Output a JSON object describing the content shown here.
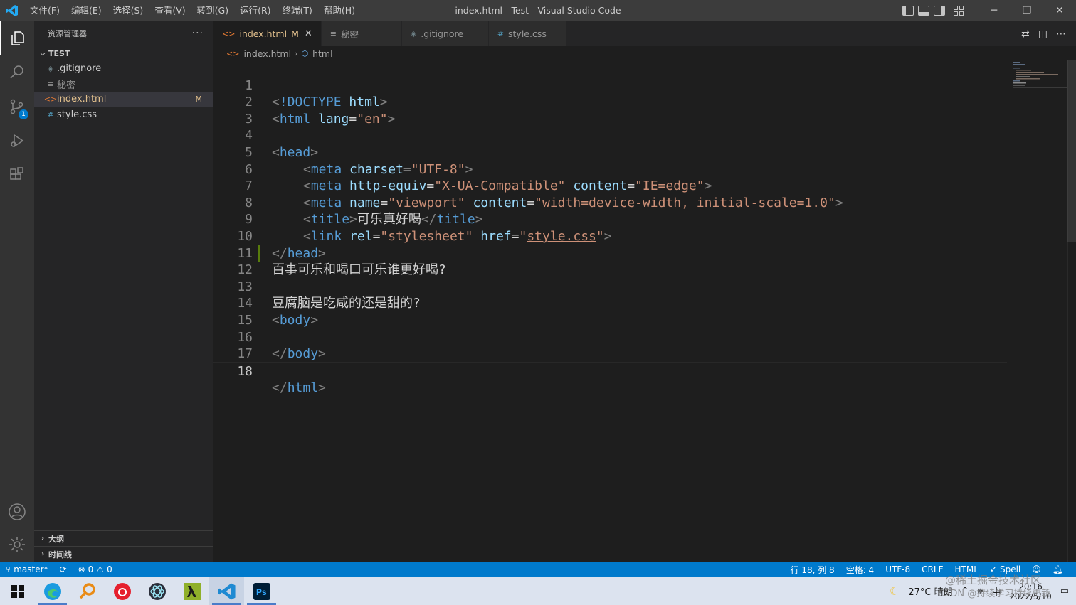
{
  "window": {
    "title": "index.html - Test - Visual Studio Code",
    "menu": [
      "文件(F)",
      "编辑(E)",
      "选择(S)",
      "查看(V)",
      "转到(G)",
      "运行(R)",
      "终端(T)",
      "帮助(H)"
    ],
    "minimize": "─",
    "restore": "❐",
    "close": "✕"
  },
  "activity": {
    "scm_badge": "1"
  },
  "sidebar": {
    "title": "资源管理器",
    "more": "···",
    "section": "TEST",
    "files": [
      {
        "name": ".gitignore",
        "icon": "◈"
      },
      {
        "name": "秘密",
        "icon": "≡"
      },
      {
        "name": "index.html",
        "icon": "<>",
        "status": "M"
      },
      {
        "name": "style.css",
        "icon": "#"
      }
    ],
    "outline": "大纲",
    "timeline": "时间线"
  },
  "tabs": [
    {
      "label": "index.html",
      "icon": "<>",
      "status": "M",
      "close": "✕"
    },
    {
      "label": "秘密",
      "icon": "≡"
    },
    {
      "label": ".gitignore",
      "icon": "◈"
    },
    {
      "label": "style.css",
      "icon": "#"
    }
  ],
  "breadcrumb": {
    "file": "index.html",
    "sep": "›",
    "symbol": "html"
  },
  "editor": {
    "lines": [
      {
        "n": "1"
      },
      {
        "n": "2"
      },
      {
        "n": "3"
      },
      {
        "n": "4"
      },
      {
        "n": "5"
      },
      {
        "n": "6"
      },
      {
        "n": "7"
      },
      {
        "n": "8"
      },
      {
        "n": "9"
      },
      {
        "n": "10"
      },
      {
        "n": "11"
      },
      {
        "n": "12"
      },
      {
        "n": "13"
      },
      {
        "n": "14"
      },
      {
        "n": "15"
      },
      {
        "n": "16"
      },
      {
        "n": "17"
      },
      {
        "n": "18"
      }
    ],
    "tok": {
      "lt": "<",
      "gt": ">",
      "lts": "</",
      "eq": "=",
      "q": "\"",
      "sp": " ",
      "doctype": "!DOCTYPE",
      "html": "html",
      "lang": "lang",
      "en": "\"en\"",
      "head": "head",
      "meta": "meta",
      "charset": "charset",
      "utf8": "\"UTF-8\"",
      "httpequiv": "http-equiv",
      "xua": "\"X-UA-Compatible\"",
      "content": "content",
      "ieedge": "\"IE=edge\"",
      "name": "name",
      "viewport": "\"viewport\"",
      "vpcontent": "\"width=device-width, initial-scale=1.0\"",
      "title": "title",
      "titletext": "可乐真好喝",
      "link": "link",
      "rel": "rel",
      "stylesheet": "\"stylesheet\"",
      "href": "href",
      "stylecss": "style.css",
      "line11": "百事可乐和喝口可乐谁更好喝?",
      "line12": "豆腐脑是吃咸的还是甜的?",
      "body": "body"
    }
  },
  "status": {
    "branch": "master*",
    "errors": "0",
    "warnings": "0",
    "position": "行 18, 列 8",
    "spaces": "空格: 4",
    "encoding": "UTF-8",
    "eol": "CRLF",
    "language": "HTML",
    "spell": "Spell"
  },
  "taskbar": {
    "weather": "27°C 晴朗",
    "ime": "中",
    "time": "20:16",
    "date": "2022/5/10"
  },
  "watermark": {
    "line1": "@稀土掘金技术社区",
    "line2": "CSDN @持续学习持续更新"
  },
  "colors": {
    "accent": "#007acc",
    "modified": "#e2c08d",
    "tag": "#569cd6",
    "attr": "#9cdcfe",
    "string": "#ce9178"
  }
}
